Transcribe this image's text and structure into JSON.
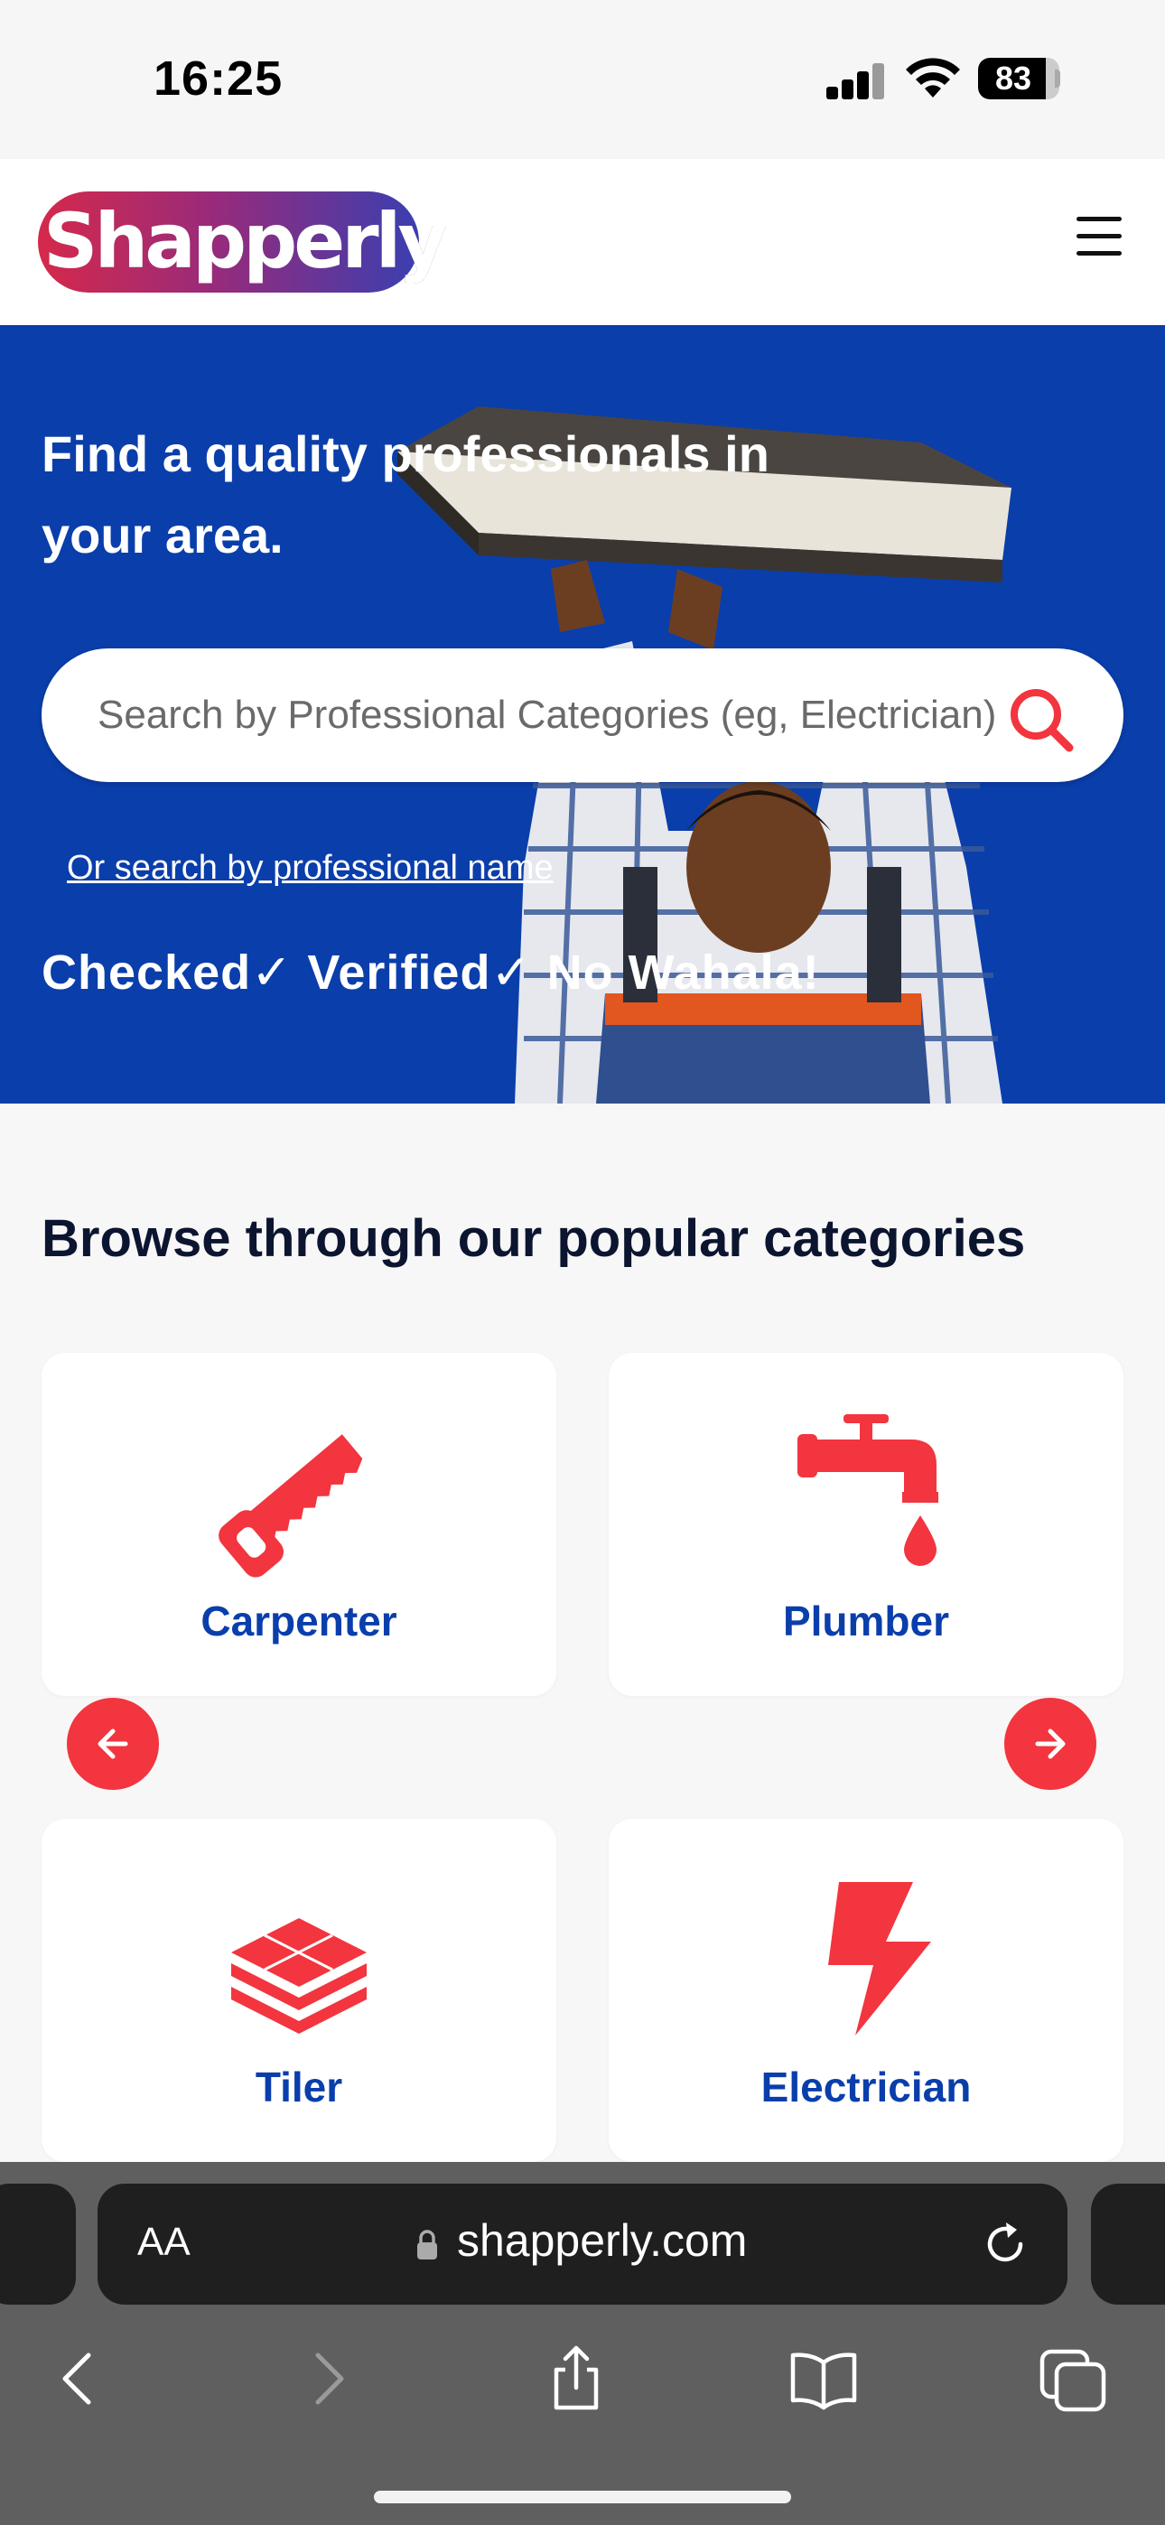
{
  "status_bar": {
    "time": "16:25",
    "battery": "83",
    "battery_level": 0.83
  },
  "header": {
    "logo_text": "Shapperly",
    "menu_icon": "hamburger-icon"
  },
  "hero": {
    "title": "Find a quality professionals in your area.",
    "search_placeholder": "Search by Professional Categories (eg, Electrician)",
    "search_icon": "search-icon",
    "alt_search_link": "Or search by professional name",
    "tagline": "Checked✓ Verified✓ No Wahala!",
    "background_color": "#0a3eab"
  },
  "categories": {
    "heading": "Browse through our popular categories",
    "items": [
      {
        "label": "Carpenter",
        "icon": "saw-icon"
      },
      {
        "label": "Plumber",
        "icon": "faucet-icon"
      },
      {
        "label": "Tiler",
        "icon": "tiles-icon"
      },
      {
        "label": "Electrician",
        "icon": "lightning-icon"
      }
    ],
    "prev_icon": "arrow-left-icon",
    "next_icon": "arrow-right-icon",
    "accent_color": "#f2353e"
  },
  "browser": {
    "text_size_label": "AA",
    "url": "shapperly.com",
    "toolbar": [
      "back-icon",
      "forward-icon",
      "share-icon",
      "bookmarks-icon",
      "tabs-icon"
    ]
  }
}
